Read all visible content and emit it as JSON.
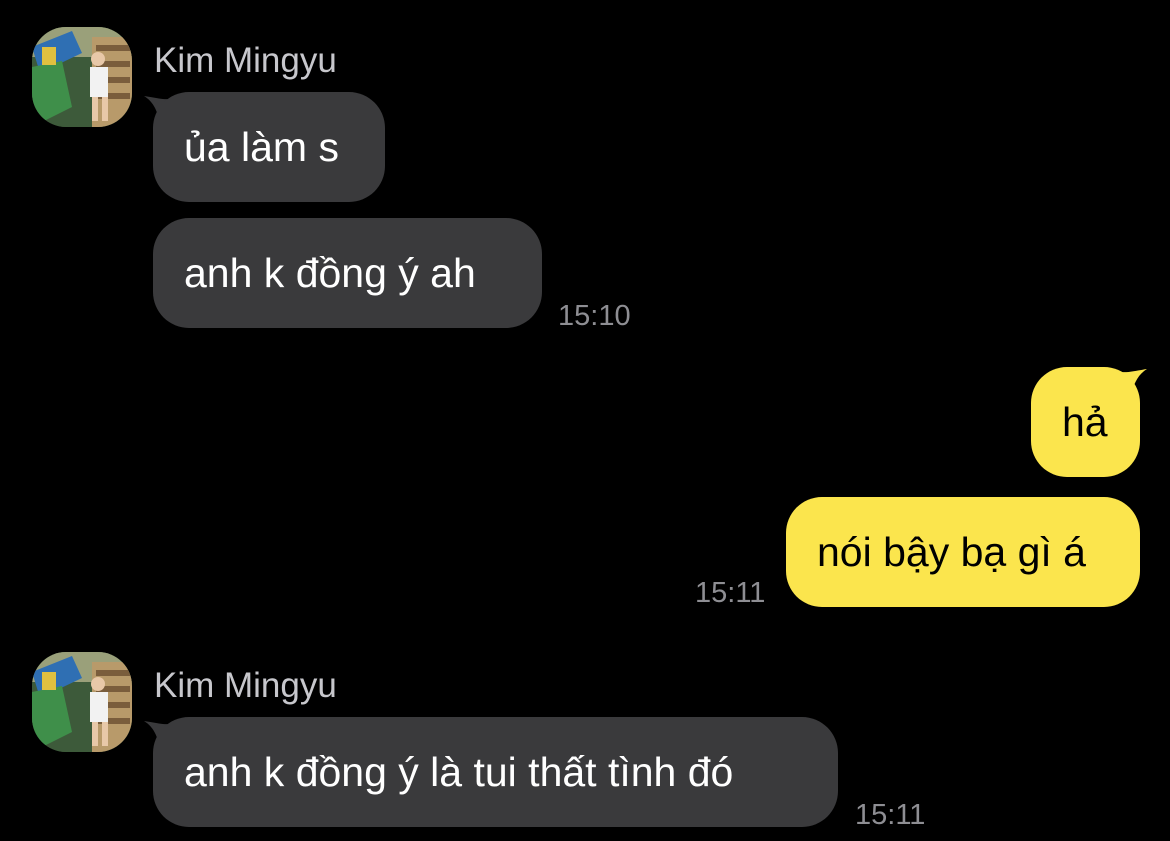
{
  "colors": {
    "background": "#000000",
    "incoming_bubble": "#3a3a3c",
    "outgoing_bubble": "#fbe54d",
    "name_text": "#c7c7cc",
    "time_text": "#8e8e93"
  },
  "chat": {
    "groups": [
      {
        "sender": "Kim Mingyu",
        "avatar": "profile-photo",
        "messages": [
          {
            "text": "ủa làm s"
          },
          {
            "text": "anh k đồng ý ah"
          }
        ],
        "time": "15:10"
      },
      {
        "sender": "me",
        "messages": [
          {
            "text": "hả"
          },
          {
            "text": "nói bậy bạ gì á"
          }
        ],
        "time": "15:11"
      },
      {
        "sender": "Kim Mingyu",
        "avatar": "profile-photo",
        "messages": [
          {
            "text": "anh k đồng ý là tui thất tình đó"
          }
        ],
        "time": "15:11"
      }
    ]
  }
}
